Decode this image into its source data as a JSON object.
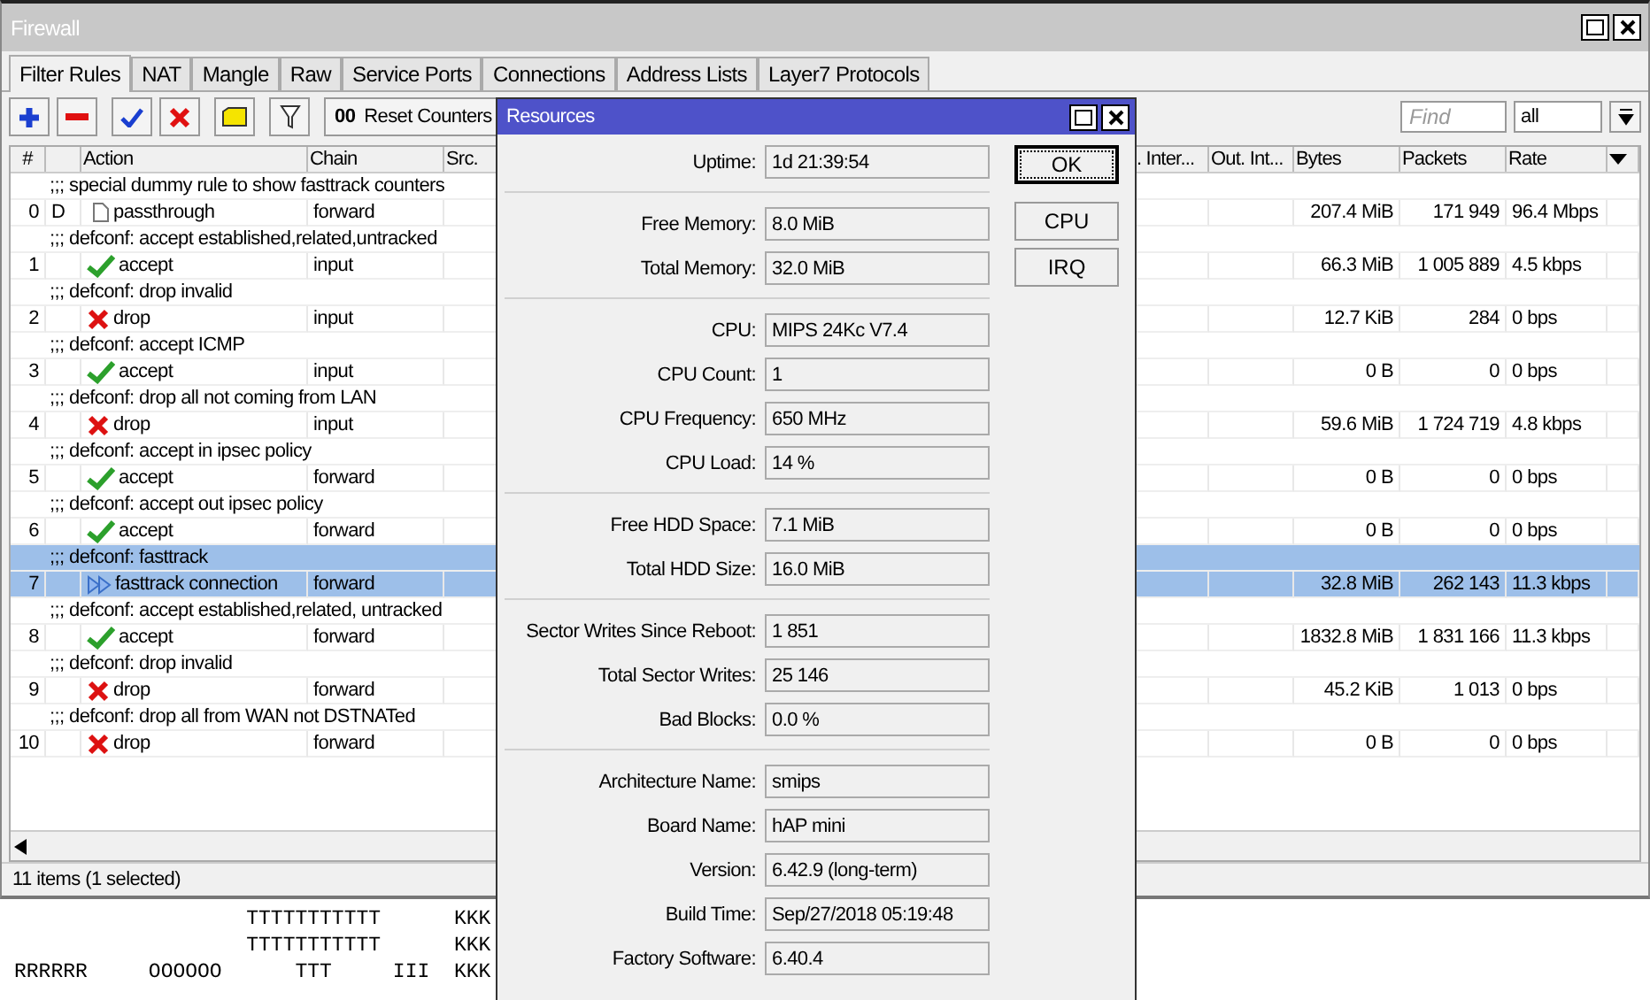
{
  "firewall": {
    "title": "Firewall",
    "tabs": [
      {
        "label": "Filter Rules",
        "selected": true
      },
      {
        "label": "NAT",
        "selected": false
      },
      {
        "label": "Mangle",
        "selected": false
      },
      {
        "label": "Raw",
        "selected": false
      },
      {
        "label": "Service Ports",
        "selected": false
      },
      {
        "label": "Connections",
        "selected": false
      },
      {
        "label": "Address Lists",
        "selected": false
      },
      {
        "label": "Layer7 Protocols",
        "selected": false
      }
    ],
    "toolbar": {
      "reset_icon": "00",
      "reset_label": "Reset Counters",
      "find": {
        "placeholder": "Find"
      },
      "filter_value": "all"
    },
    "columns": {
      "number": "#",
      "action": "Action",
      "chain": "Chain",
      "src": "Src.",
      "in_interface": ". Inter...",
      "out_interface": "Out. Int...",
      "bytes": "Bytes",
      "packets": "Packets",
      "rate": "Rate"
    },
    "rows": [
      {
        "comment": ";;; special dummy rule to show fasttrack counters",
        "number": "0",
        "flag": "D",
        "action": {
          "kind": "passthrough",
          "label": "passthrough"
        },
        "chain": "forward",
        "bytes": "207.4 MiB",
        "packets": "171 949",
        "rate": "96.4 Mbps",
        "selected": false
      },
      {
        "comment": ";;; defconf: accept established,related,untracked",
        "number": "1",
        "action": {
          "kind": "accept",
          "label": "accept"
        },
        "chain": "input",
        "bytes": "66.3 MiB",
        "packets": "1 005 889",
        "rate": "4.5 kbps",
        "selected": false
      },
      {
        "comment": ";;; defconf: drop invalid",
        "number": "2",
        "action": {
          "kind": "drop",
          "label": "drop"
        },
        "chain": "input",
        "bytes": "12.7 KiB",
        "packets": "284",
        "rate": "0 bps",
        "selected": false
      },
      {
        "comment": ";;; defconf: accept ICMP",
        "number": "3",
        "action": {
          "kind": "accept",
          "label": "accept"
        },
        "chain": "input",
        "bytes": "0 B",
        "packets": "0",
        "rate": "0 bps",
        "selected": false
      },
      {
        "comment": ";;; defconf: drop all not coming from LAN",
        "number": "4",
        "action": {
          "kind": "drop",
          "label": "drop"
        },
        "chain": "input",
        "bytes": "59.6 MiB",
        "packets": "1 724 719",
        "rate": "4.8 kbps",
        "selected": false
      },
      {
        "comment": ";;; defconf: accept in ipsec policy",
        "number": "5",
        "action": {
          "kind": "accept",
          "label": "accept"
        },
        "chain": "forward",
        "bytes": "0 B",
        "packets": "0",
        "rate": "0 bps",
        "selected": false
      },
      {
        "comment": ";;; defconf: accept out ipsec policy",
        "number": "6",
        "action": {
          "kind": "accept",
          "label": "accept"
        },
        "chain": "forward",
        "bytes": "0 B",
        "packets": "0",
        "rate": "0 bps",
        "selected": false
      },
      {
        "comment": ";;; defconf: fasttrack",
        "number": "7",
        "action": {
          "kind": "fasttrack",
          "label": "fasttrack connection"
        },
        "chain": "forward",
        "bytes": "32.8 MiB",
        "packets": "262 143",
        "rate": "11.3 kbps",
        "selected": true
      },
      {
        "comment": ";;; defconf: accept established,related, untracked",
        "number": "8",
        "action": {
          "kind": "accept",
          "label": "accept"
        },
        "chain": "forward",
        "bytes": "1832.8 MiB",
        "packets": "1 831 166",
        "rate": "11.3 kbps",
        "selected": false
      },
      {
        "comment": ";;; defconf: drop invalid",
        "number": "9",
        "action": {
          "kind": "drop",
          "label": "drop"
        },
        "chain": "forward",
        "bytes": "45.2 KiB",
        "packets": "1 013",
        "rate": "0 bps",
        "selected": false
      },
      {
        "comment": ";;; defconf:  drop all from WAN not DSTNATed",
        "number": "10",
        "action": {
          "kind": "drop",
          "label": "drop"
        },
        "chain": "forward",
        "bytes": "0 B",
        "packets": "0",
        "rate": "0 bps",
        "selected": false
      }
    ],
    "status": "11 items (1 selected)"
  },
  "terminal": {
    "lines": [
      "                   TTTTTTTTTTT      KKK",
      "                   TTTTTTTTTTT      KKK",
      "RRRRRR     OOOOOO      TTT     III  KKK"
    ]
  },
  "resources": {
    "title": "Resources",
    "groups": [
      [
        {
          "label": "Uptime:",
          "value": "1d 21:39:54"
        }
      ],
      [
        {
          "label": "Free Memory:",
          "value": "8.0 MiB"
        },
        {
          "label": "Total Memory:",
          "value": "32.0 MiB"
        }
      ],
      [
        {
          "label": "CPU:",
          "value": "MIPS 24Kc V7.4"
        },
        {
          "label": "CPU Count:",
          "value": "1"
        },
        {
          "label": "CPU Frequency:",
          "value": "650 MHz"
        },
        {
          "label": "CPU Load:",
          "value": "14 %"
        }
      ],
      [
        {
          "label": "Free HDD Space:",
          "value": "7.1 MiB"
        },
        {
          "label": "Total HDD Size:",
          "value": "16.0 MiB"
        }
      ],
      [
        {
          "label": "Sector Writes Since Reboot:",
          "value": "1 851"
        },
        {
          "label": "Total Sector Writes:",
          "value": "25 146"
        },
        {
          "label": "Bad Blocks:",
          "value": "0.0 %"
        }
      ],
      [
        {
          "label": "Architecture Name:",
          "value": "smips"
        },
        {
          "label": "Board Name:",
          "value": "hAP mini"
        },
        {
          "label": "Version:",
          "value": "6.42.9 (long-term)"
        },
        {
          "label": "Build Time:",
          "value": "Sep/27/2018 05:19:48"
        },
        {
          "label": "Factory Software:",
          "value": "6.40.4"
        }
      ]
    ],
    "buttons": [
      {
        "label": "OK",
        "focused": true
      },
      {
        "label": "CPU",
        "focused": false
      },
      {
        "label": "IRQ",
        "focused": false
      }
    ]
  }
}
